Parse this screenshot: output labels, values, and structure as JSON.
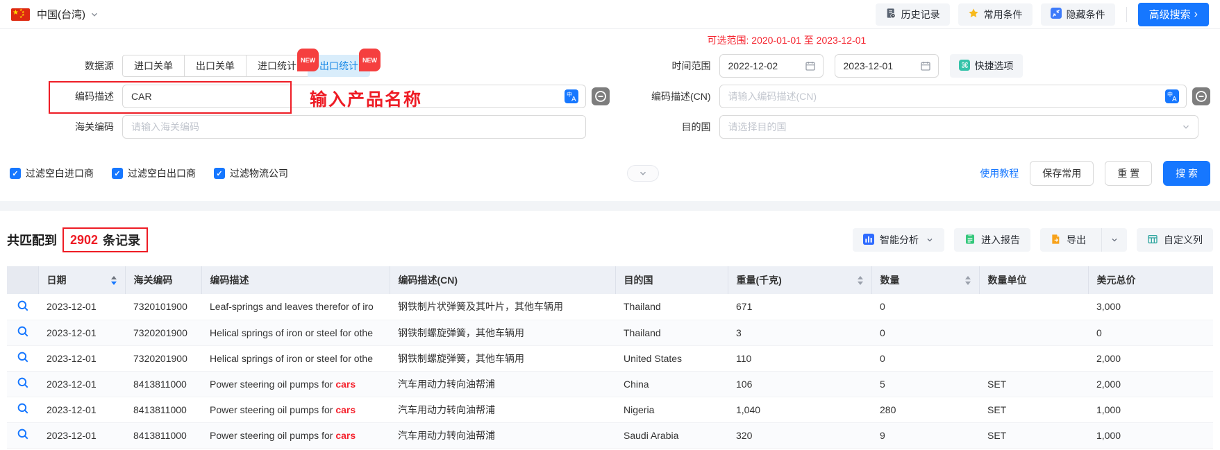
{
  "topbar": {
    "country": "中国(台湾)",
    "history": "历史记录",
    "favorites": "常用条件",
    "hide": "隐藏条件",
    "advanced": "高级搜索",
    "advanced_arrow": "›"
  },
  "filters": {
    "datasource_label": "数据源",
    "tabs": [
      {
        "label": "进口关单"
      },
      {
        "label": "出口关单"
      },
      {
        "label": "进口统计",
        "badge": "NEW"
      },
      {
        "label": "出口统计",
        "badge": "NEW"
      }
    ],
    "date_hint": "可选范围: 2020-01-01 至 2023-12-01",
    "time_label": "时间范围",
    "date_from": "2022-12-02",
    "date_to": "2023-12-01",
    "quick_label": "快捷选项",
    "desc_label": "编码描述",
    "desc_value": "CAR",
    "desc_annotation": "输入产品名称",
    "desc_cn_label": "编码描述(CN)",
    "desc_cn_placeholder": "请输入编码描述(CN)",
    "hs_label": "海关编码",
    "hs_placeholder": "请输入海关编码",
    "dest_label": "目的国",
    "dest_placeholder": "请选择目的国",
    "checkbox_1": "过滤空白进口商",
    "checkbox_2": "过滤空白出口商",
    "checkbox_3": "过滤物流公司",
    "tutorial": "使用教程",
    "save": "保存常用",
    "reset": "重 置",
    "search": "搜 索"
  },
  "results": {
    "count_prefix": "共匹配到",
    "count": "2902",
    "count_suffix": "条记录",
    "analysis": "智能分析",
    "report": "进入报告",
    "export": "导出",
    "custom_columns": "自定义列"
  },
  "table": {
    "headers": {
      "date": "日期",
      "hs": "海关编码",
      "desc": "编码描述",
      "desc_cn": "编码描述(CN)",
      "country": "目的国",
      "weight": "重量(千克)",
      "qty": "数量",
      "unit": "数量单位",
      "usd": "美元总价"
    },
    "rows": [
      {
        "date": "2023-12-01",
        "hs": "7320101900",
        "desc": "Leaf-springs and leaves therefor of iro",
        "desc_hl": "",
        "desc_cn": "钢铁制片状弹簧及其叶片，其他车辆用",
        "country": "Thailand",
        "weight": "671",
        "qty": "0",
        "unit": "",
        "usd": "3,000"
      },
      {
        "date": "2023-12-01",
        "hs": "7320201900",
        "desc": "Helical springs of iron or steel for othe",
        "desc_hl": "",
        "desc_cn": "钢铁制螺旋弹簧，其他车辆用",
        "country": "Thailand",
        "weight": "3",
        "qty": "0",
        "unit": "",
        "usd": "0"
      },
      {
        "date": "2023-12-01",
        "hs": "7320201900",
        "desc": "Helical springs of iron or steel for othe",
        "desc_hl": "",
        "desc_cn": "钢铁制螺旋弹簧，其他车辆用",
        "country": "United States",
        "weight": "110",
        "qty": "0",
        "unit": "",
        "usd": "2,000"
      },
      {
        "date": "2023-12-01",
        "hs": "8413811000",
        "desc": "Power steering oil pumps for ",
        "desc_hl": "cars",
        "desc_cn": "汽车用动力转向油帮浦",
        "country": "China",
        "weight": "106",
        "qty": "5",
        "unit": "SET",
        "usd": "2,000"
      },
      {
        "date": "2023-12-01",
        "hs": "8413811000",
        "desc": "Power steering oil pumps for ",
        "desc_hl": "cars",
        "desc_cn": "汽车用动力转向油帮浦",
        "country": "Nigeria",
        "weight": "1,040",
        "qty": "280",
        "unit": "SET",
        "usd": "1,000"
      },
      {
        "date": "2023-12-01",
        "hs": "8413811000",
        "desc": "Power steering oil pumps for ",
        "desc_hl": "cars",
        "desc_cn": "汽车用动力转向油帮浦",
        "country": "Saudi Arabia",
        "weight": "320",
        "qty": "9",
        "unit": "SET",
        "usd": "1,000"
      }
    ]
  },
  "colors": {
    "accent": "#1677ff",
    "annotation_red": "#ee1c25",
    "badge_red": "#f53f3f"
  }
}
